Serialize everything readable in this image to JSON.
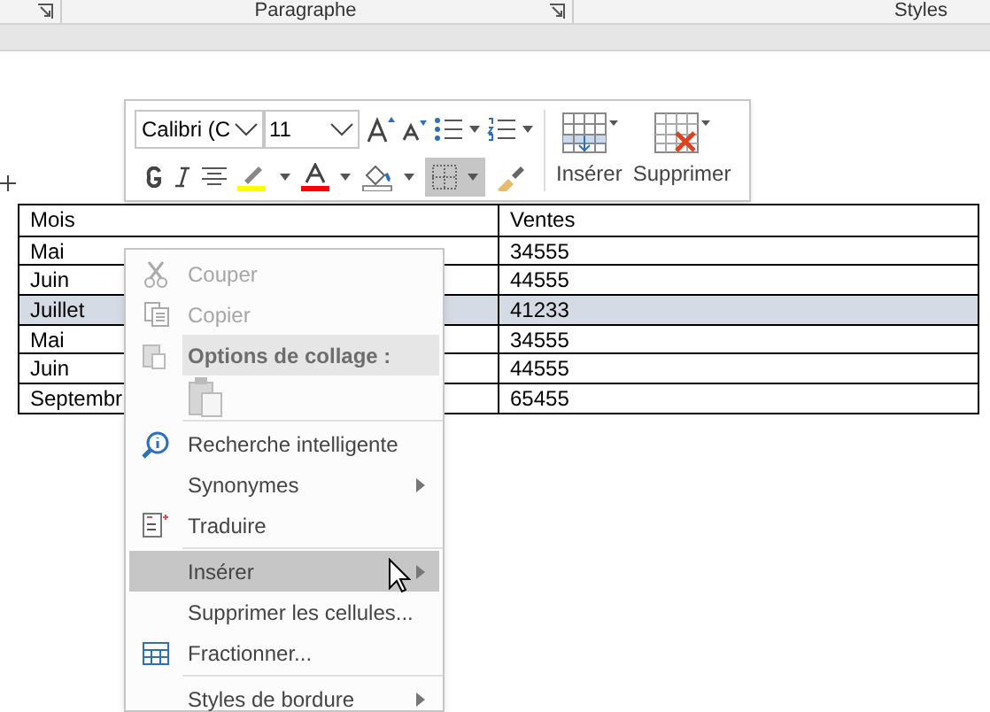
{
  "ribbon": {
    "groups": [
      {
        "label": "Paragraphe"
      },
      {
        "label": "Styles"
      }
    ]
  },
  "table": {
    "rows": [
      {
        "cells": [
          "Mois",
          "Ventes"
        ],
        "selected": false
      },
      {
        "cells": [
          "Mai",
          "34555"
        ],
        "selected": false
      },
      {
        "cells": [
          "Juin",
          "44555"
        ],
        "selected": false
      },
      {
        "cells": [
          "Juillet",
          "41233"
        ],
        "selected": true
      },
      {
        "cells": [
          "Mai",
          "34555"
        ],
        "selected": false
      },
      {
        "cells": [
          "Juin",
          "44555"
        ],
        "selected": false
      },
      {
        "cells": [
          "Septembr",
          "65455"
        ],
        "selected": false
      }
    ]
  },
  "mini_toolbar": {
    "font": "Calibri (C",
    "size": "11",
    "borders_selected": true,
    "insert_label": "Insérer",
    "delete_label": "Supprimer"
  },
  "context_menu": [
    {
      "kind": "cut",
      "label": "Couper",
      "disabled": true,
      "selected": false
    },
    {
      "kind": "copy",
      "label": "Copier",
      "disabled": true,
      "selected": false
    },
    {
      "kind": "header",
      "label": "Options de collage :"
    },
    {
      "kind": "paste"
    },
    {
      "kind": "separator"
    },
    {
      "kind": "lookup",
      "label": "Recherche intelligente",
      "disabled": false,
      "selected": false
    },
    {
      "kind": "submenu",
      "label": "Synonymes",
      "disabled": false,
      "selected": false
    },
    {
      "kind": "translate",
      "label": "Traduire",
      "disabled": false,
      "selected": false
    },
    {
      "kind": "separator"
    },
    {
      "kind": "submenu",
      "label": "Insérer",
      "disabled": false,
      "selected": true
    },
    {
      "kind": "item",
      "label": "Supprimer les cellules...",
      "disabled": false,
      "selected": false
    },
    {
      "kind": "split",
      "label": "Fractionner...",
      "disabled": false,
      "selected": false
    },
    {
      "kind": "separator"
    },
    {
      "kind": "submenu",
      "label": "Styles de bordure",
      "disabled": false,
      "selected": false
    }
  ]
}
